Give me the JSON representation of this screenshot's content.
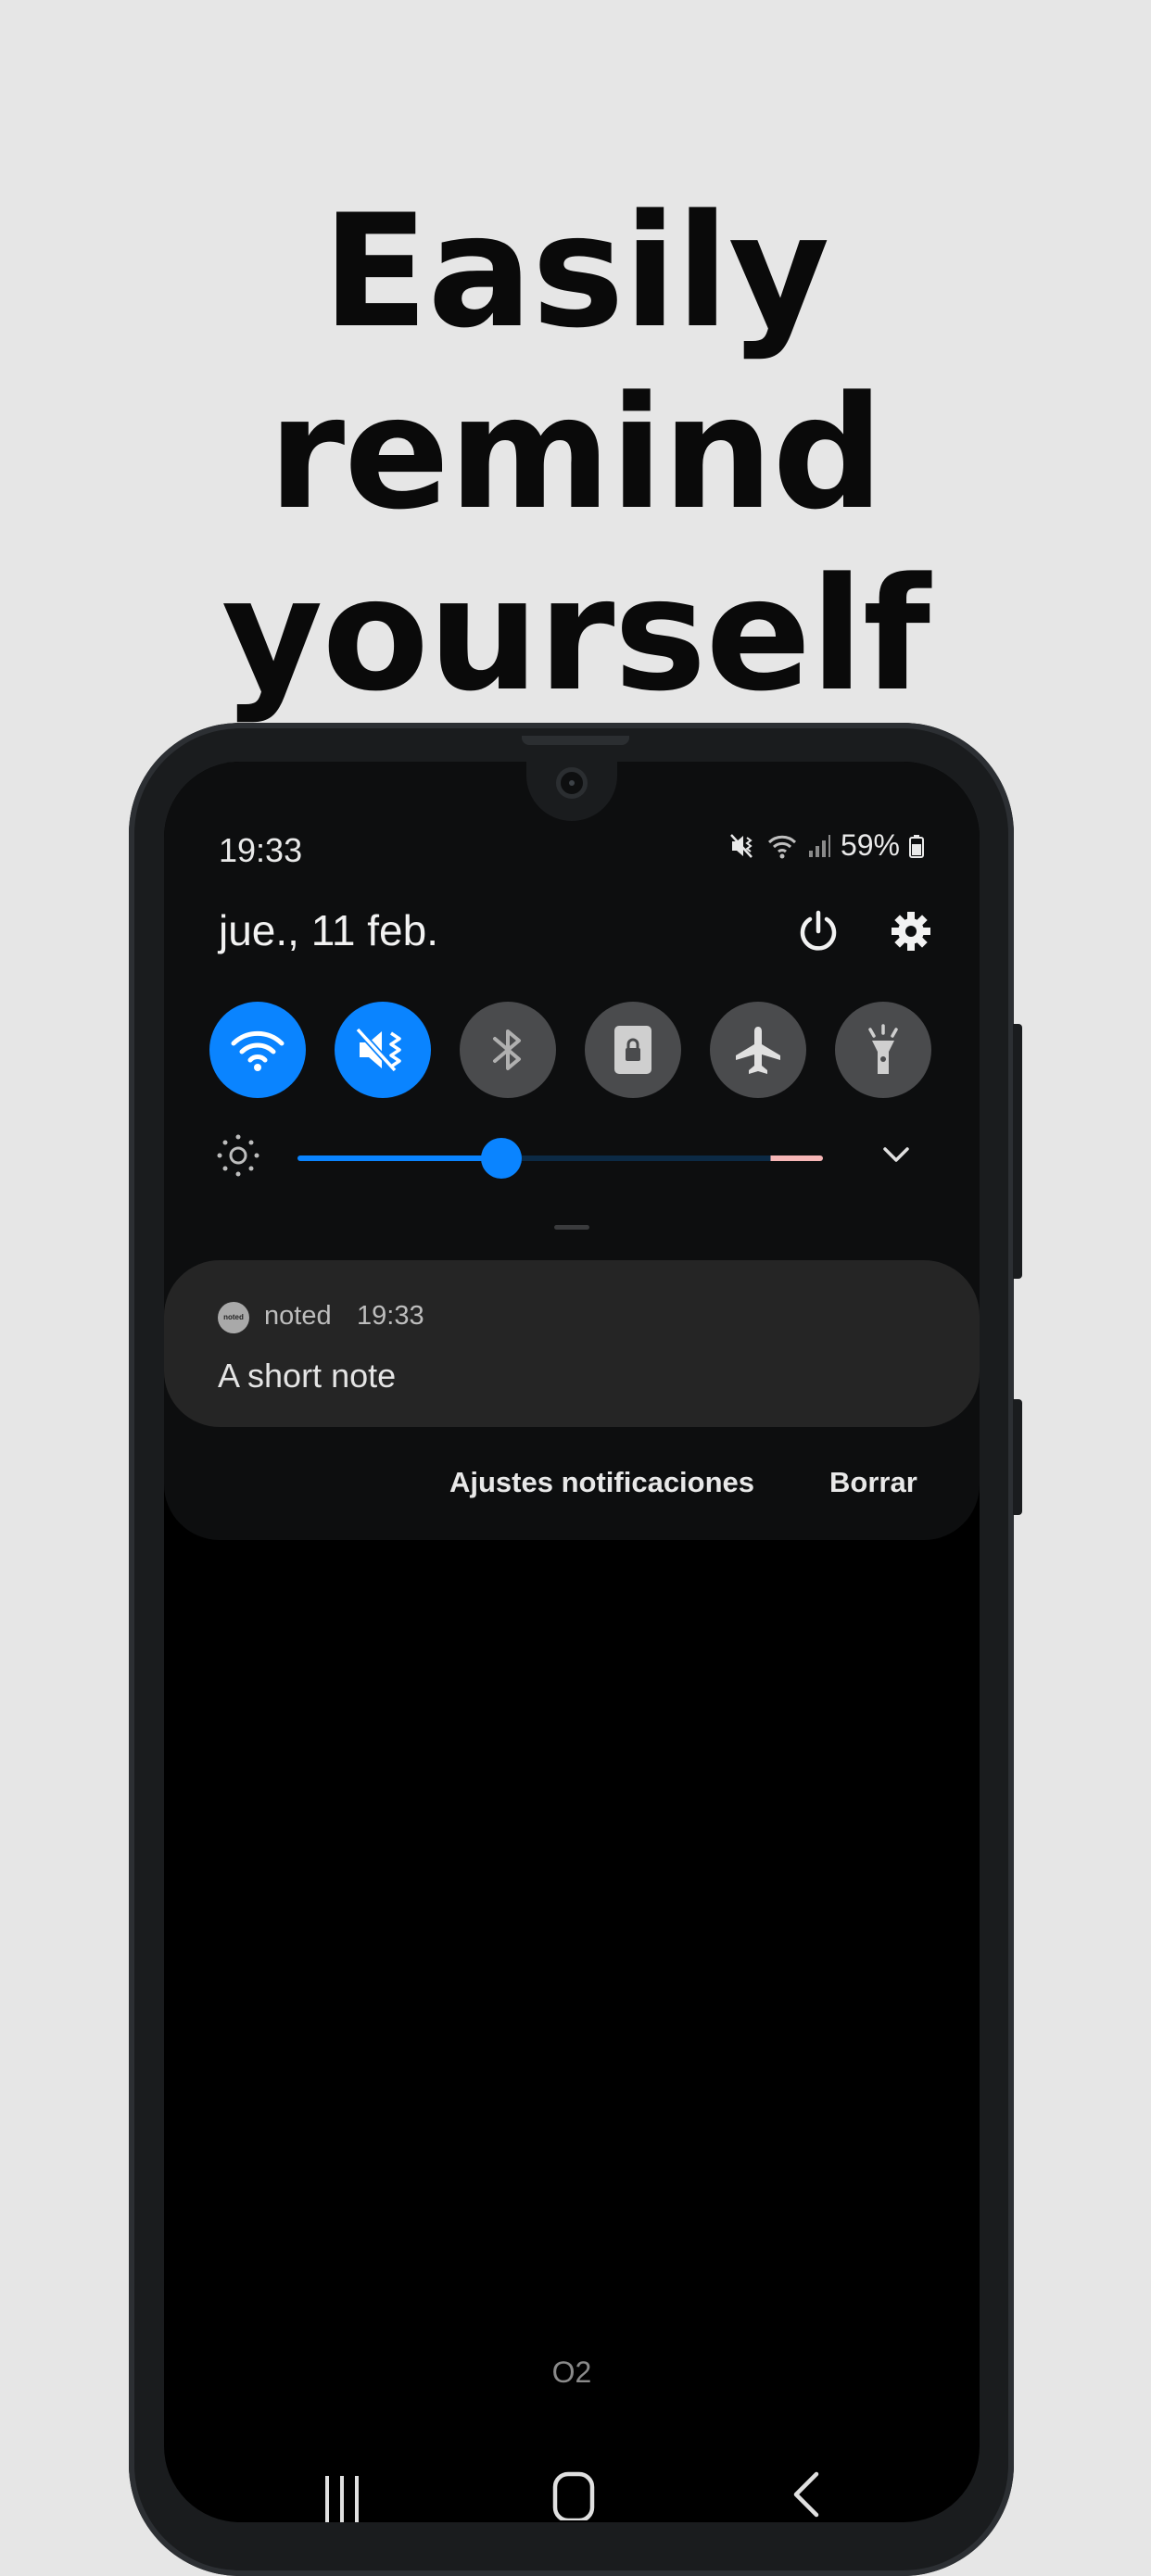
{
  "headline": {
    "line1": "Easily remind",
    "line2": "yourself"
  },
  "status_bar": {
    "time": "19:33",
    "battery": "59%"
  },
  "quick_panel": {
    "date": "jue., 11 feb.",
    "tiles": [
      {
        "icon": "wifi-icon",
        "state": "on"
      },
      {
        "icon": "mute-icon",
        "state": "on"
      },
      {
        "icon": "bluetooth-icon",
        "state": "off"
      },
      {
        "icon": "screen-lock-icon",
        "state": "off"
      },
      {
        "icon": "airplane-icon",
        "state": "off"
      },
      {
        "icon": "flashlight-icon",
        "state": "off"
      }
    ],
    "brightness_level": 0.38
  },
  "notification": {
    "app_name": "noted",
    "app_icon_text": "noted",
    "time": "19:33",
    "text": "A short note"
  },
  "actions": {
    "settings_label": "Ajustes notificaciones",
    "clear_label": "Borrar"
  },
  "carrier": "O2",
  "colors": {
    "accent": "#0a84ff",
    "panel": "#0d0e0f",
    "card": "#252525",
    "background": "#e6e6e6"
  }
}
